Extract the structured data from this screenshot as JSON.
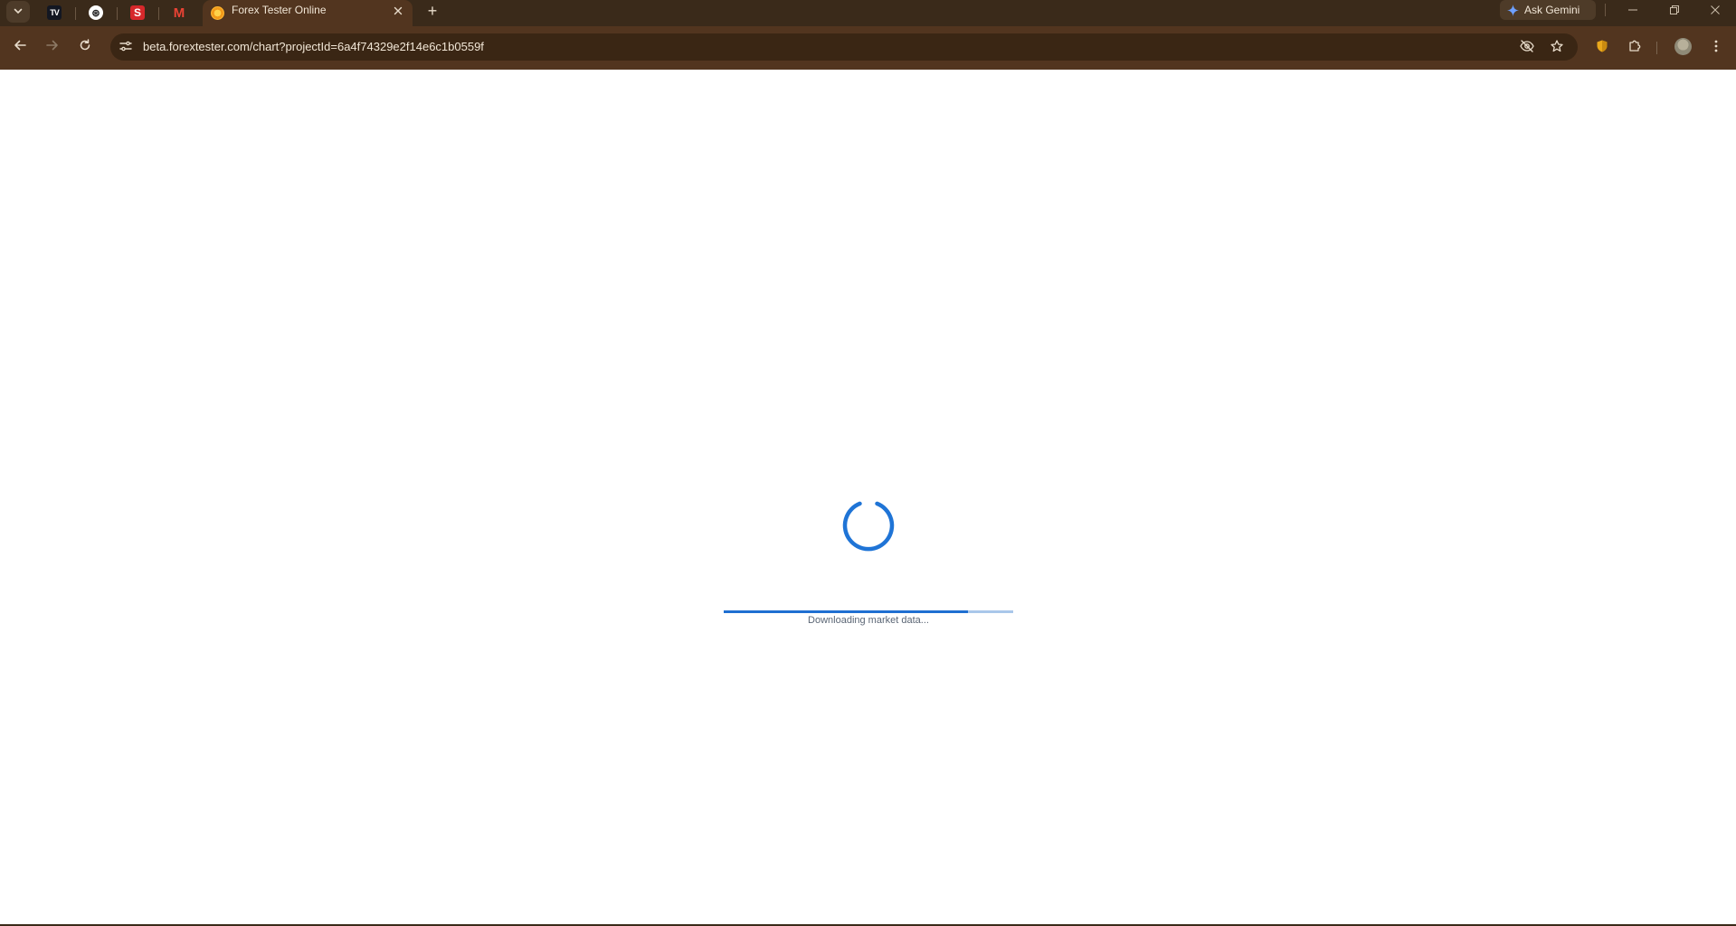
{
  "browser": {
    "tab_search_icon": "chevron-down-icon",
    "pinned_tabs": [
      {
        "name": "TradingView",
        "icon": "tradingview-icon",
        "glyph": "TV"
      },
      {
        "name": "ChatGPT",
        "icon": "chatgpt-icon",
        "glyph": "⊛"
      },
      {
        "name": "S",
        "icon": "s-app-icon",
        "glyph": "S"
      },
      {
        "name": "Gmail",
        "icon": "gmail-icon",
        "glyph": "M"
      }
    ],
    "active_tab": {
      "title": "Forex Tester Online",
      "favicon": "forextester-icon"
    },
    "new_tab_glyph": "+",
    "gemini_button_label": "Ask Gemini",
    "address_bar": {
      "url": "beta.forextester.com/chart?projectId=6a4f74329e2f14e6c1b0559f"
    },
    "colors": {
      "tabstrip": "#3a2a1a",
      "toolbar": "#52351f",
      "omnibox": "#3a2614",
      "accent_blue": "#1f6fd1",
      "track_blue": "#a9c7ea"
    }
  },
  "page": {
    "loading": {
      "status_text": "Downloading market data...",
      "progress_fraction": 0.845
    }
  }
}
